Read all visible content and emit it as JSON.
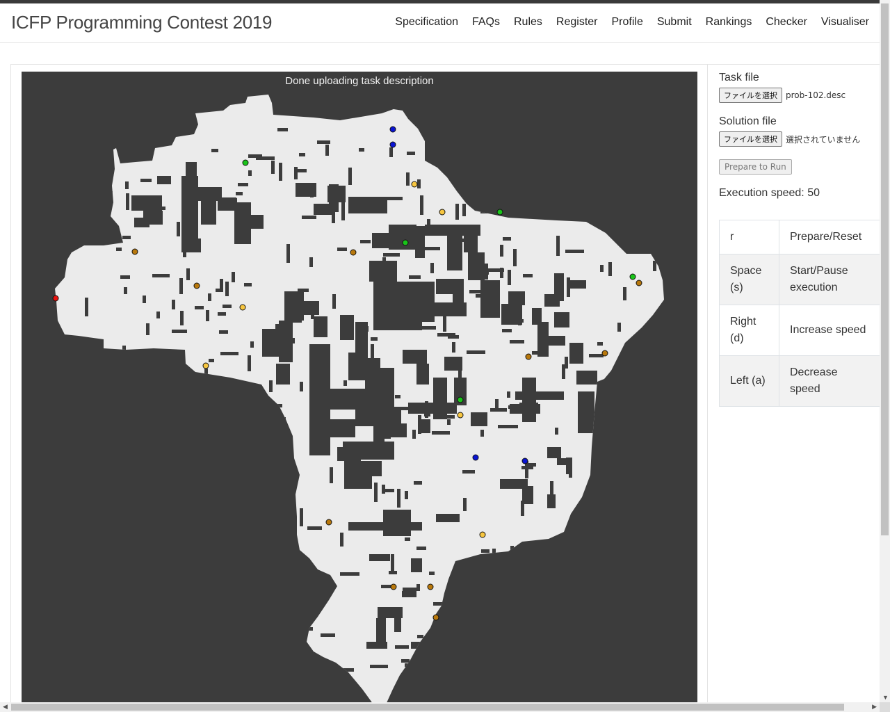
{
  "brand": "ICFP Programming Contest 2019",
  "nav": [
    "Specification",
    "FAQs",
    "Rules",
    "Register",
    "Profile",
    "Submit",
    "Rankings",
    "Checker",
    "Visualiser"
  ],
  "canvas": {
    "status": "Done uploading task description",
    "colors": {
      "background": "#3c3c3c",
      "floor": "#ebebeb",
      "wall": "#3c3c3c"
    }
  },
  "task_file": {
    "label": "Task file",
    "button": "ファイルを選択",
    "filename": "prob-102.desc"
  },
  "solution_file": {
    "label": "Solution file",
    "button": "ファイルを選択",
    "filename": "選択されていません"
  },
  "prepare_button": "Prepare to Run",
  "speed": {
    "label": "Execution speed: ",
    "value": "50"
  },
  "keys": [
    {
      "key": "r",
      "action": "Prepare/Reset"
    },
    {
      "key": "Space (s)",
      "action": "Start/Pause execution"
    },
    {
      "key": "Right (d)",
      "action": "Increase speed"
    },
    {
      "key": "Left (a)",
      "action": "Decrease speed"
    }
  ],
  "boosters": {
    "worker": {
      "color": "#e8130f"
    },
    "boost_colors": {
      "blue": "#0a14d2",
      "green": "#19c419",
      "yellow": "#f7c640",
      "brown": "#b8780c"
    }
  }
}
